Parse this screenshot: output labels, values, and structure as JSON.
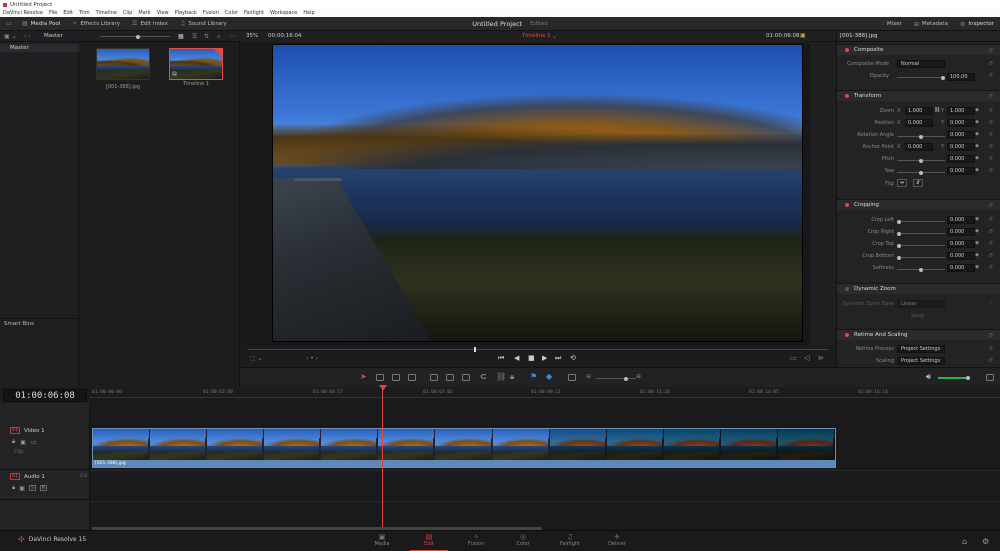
{
  "window": {
    "title": "Untitled Project"
  },
  "menu": [
    "DaVinci Resolve",
    "File",
    "Edit",
    "Trim",
    "Timeline",
    "Clip",
    "Mark",
    "View",
    "Playback",
    "Fusion",
    "Color",
    "Fairlight",
    "Workspace",
    "Help"
  ],
  "toolbar": {
    "left": [
      "Media Pool",
      "Effects Library",
      "Edit Index",
      "Sound Library"
    ],
    "project": "Untitled Project",
    "edited": "Edited",
    "right": [
      "Mixer",
      "Metadata",
      "Inspector"
    ]
  },
  "bins": {
    "header": "Master",
    "master": "Master",
    "smart": "Smart Bins"
  },
  "pool": {
    "clips": [
      {
        "name": "[001-388].jpg"
      },
      {
        "name": "Timeline 1"
      }
    ]
  },
  "viewer": {
    "zoom": "35%",
    "timecode_left": "00:00:16:04",
    "timeline": "Timeline 1",
    "timecode_right": "01:00:06:08"
  },
  "inspector": {
    "title": "[001-388].jpg",
    "composite": {
      "header": "Composite",
      "mode_label": "Composite Mode",
      "mode": "Normal",
      "opacity_label": "Opacity",
      "opacity": "100.00",
      "opacity_level": 1.0
    },
    "transform": {
      "header": "Transform",
      "zoom_label": "Zoom",
      "zoom_x": "1.000",
      "zoom_y": "1.000",
      "position_label": "Position",
      "pos_x": "0.000",
      "pos_y": "0.000",
      "rotation_label": "Rotation Angle",
      "rotation": "0.000",
      "anchor_label": "Anchor Point",
      "anchor_x": "0.000",
      "anchor_y": "0.000",
      "pitch_label": "Pitch",
      "pitch": "0.000",
      "yaw_label": "Yaw",
      "yaw": "0.000",
      "flip_label": "Flip"
    },
    "cropping": {
      "header": "Cropping",
      "left_label": "Crop Left",
      "left": "0.000",
      "right_label": "Crop Right",
      "right": "0.000",
      "top_label": "Crop Top",
      "top": "0.000",
      "bottom_label": "Crop Bottom",
      "bottom": "0.000",
      "soft_label": "Softness",
      "soft": "0.000"
    },
    "dynamic_zoom": {
      "header": "Dynamic Zoom",
      "ease_label": "Dynamic Zoom Ease",
      "ease": "Linear",
      "swap": "Swap"
    },
    "retime": {
      "header": "Retime And Scaling",
      "process_label": "Retime Process",
      "process": "Project Settings",
      "scaling_label": "Scaling",
      "scaling": "Project Settings"
    }
  },
  "timeline": {
    "timecode": "01:00:06:08",
    "ruler": [
      "01:00:00:00",
      "01:00:02:08",
      "01:00:04:17",
      "01:00:07:02",
      "01:00:09:11",
      "01:00:11:20",
      "01:00:14:05",
      "01:00:16:14"
    ],
    "video_track": {
      "tag": "V1",
      "name": "Video 1",
      "sub": "Clip"
    },
    "audio_track": {
      "tag": "A1",
      "name": "Audio 1",
      "level": "2.0",
      "s": "S",
      "m": "M"
    },
    "clip_label": "[001-388].jpg"
  },
  "pages": [
    "Media",
    "Edit",
    "Fusion",
    "Color",
    "Fairlight",
    "Deliver"
  ],
  "brand": "DaVinci Resolve 15",
  "colors": {
    "accent": "#e5453f",
    "clip": "#5d88b8"
  }
}
